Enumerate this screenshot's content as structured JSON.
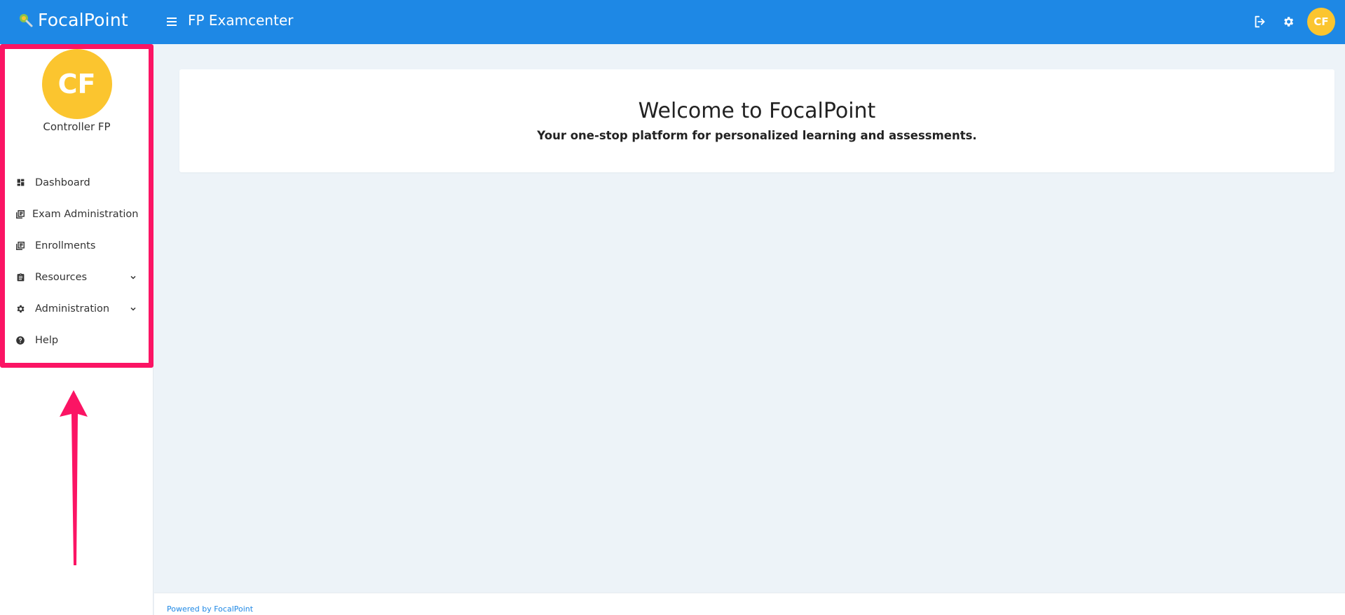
{
  "header": {
    "brand_name": "FocalPoint",
    "app_title": "FP Examcenter",
    "user_initials": "CF",
    "icons": [
      "logout-icon",
      "gear-icon"
    ]
  },
  "sidebar": {
    "avatar_initials": "CF",
    "user_name": "Controller FP",
    "items": [
      {
        "label": "Dashboard",
        "icon": "dashboard-icon",
        "expandable": false
      },
      {
        "label": "Exam Administration",
        "icon": "library-books-icon",
        "expandable": false
      },
      {
        "label": "Enrollments",
        "icon": "library-books-icon",
        "expandable": false
      },
      {
        "label": "Resources",
        "icon": "clipboard-icon",
        "expandable": true
      },
      {
        "label": "Administration",
        "icon": "gear-icon",
        "expandable": true
      },
      {
        "label": "Help",
        "icon": "help-circle-icon",
        "expandable": false
      }
    ]
  },
  "main": {
    "welcome_title": "Welcome to FocalPoint",
    "welcome_subtitle": "Your one-stop platform for personalized learning and assessments."
  },
  "footer": {
    "text": "Powered by FocalPoint"
  },
  "colors": {
    "primary": "#1e88e5",
    "avatar": "#fbc52f",
    "highlight": "#fb1464",
    "background": "#edf3f8"
  }
}
